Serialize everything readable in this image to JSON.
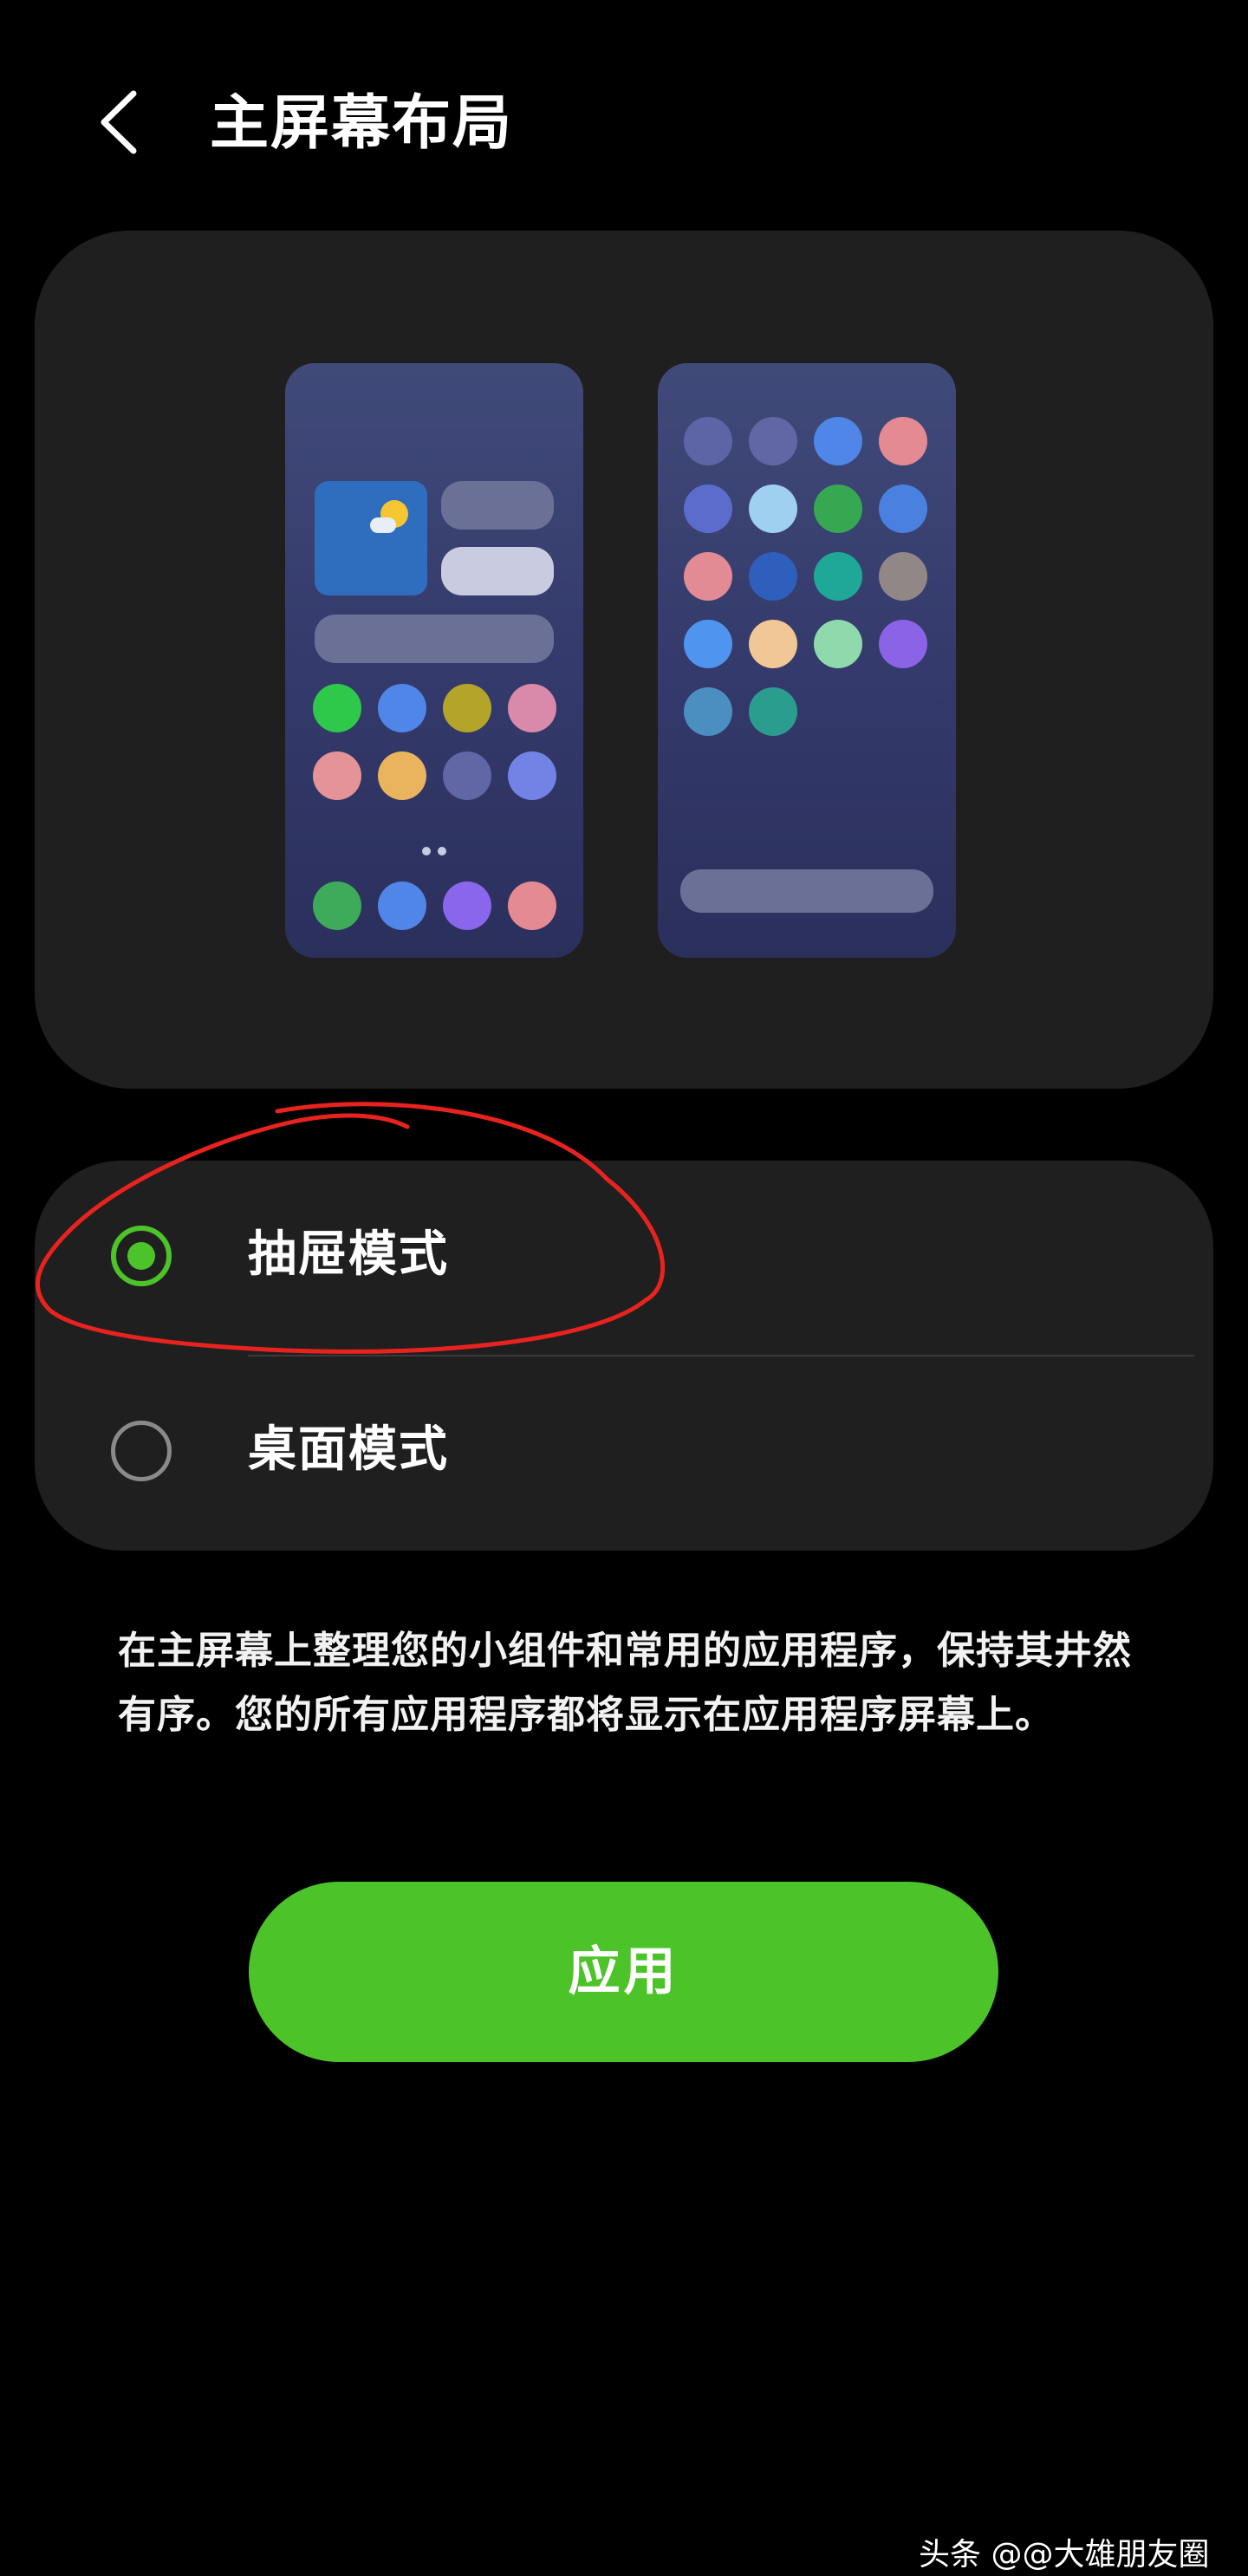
{
  "header": {
    "title": "主屏幕布局"
  },
  "layout_options": [
    {
      "label": "抽屉模式",
      "selected": true
    },
    {
      "label": "桌面模式",
      "selected": false
    }
  ],
  "description": "在主屏幕上整理您的小组件和常用的应用程序，保持其井然有序。您的所有应用程序都将显示在应用程序屏幕上。",
  "apply_button": {
    "label": "应用"
  },
  "watermark": "头条 @@大雄朋友圈",
  "colors": {
    "accent": "#4cc329",
    "background": "#000000",
    "card": "#1f1f1f",
    "annotation": "#e8231f"
  }
}
